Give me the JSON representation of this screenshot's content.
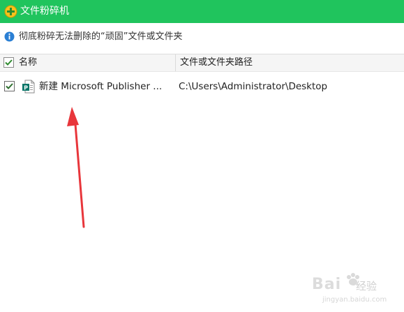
{
  "window": {
    "title": "文件粉碎机"
  },
  "info": {
    "text": "彻底粉碎无法删除的“顽固”文件或文件夹"
  },
  "table": {
    "columns": [
      "名称",
      "文件或文件夹路径"
    ],
    "rows": [
      {
        "checked": true,
        "name": "新建 Microsoft Publisher ...",
        "path": "C:\\Users\\Administrator\\Desktop",
        "icon": "publisher-file-icon"
      }
    ]
  },
  "watermark": {
    "brand": "Bai",
    "brand_suffix": "经验",
    "url": "jingyan.baidu.com"
  },
  "colors": {
    "titlebar": "#20c45d",
    "arrow": "#e8363b",
    "info_icon": "#2a7fd4",
    "check": "#2f8a2f"
  }
}
